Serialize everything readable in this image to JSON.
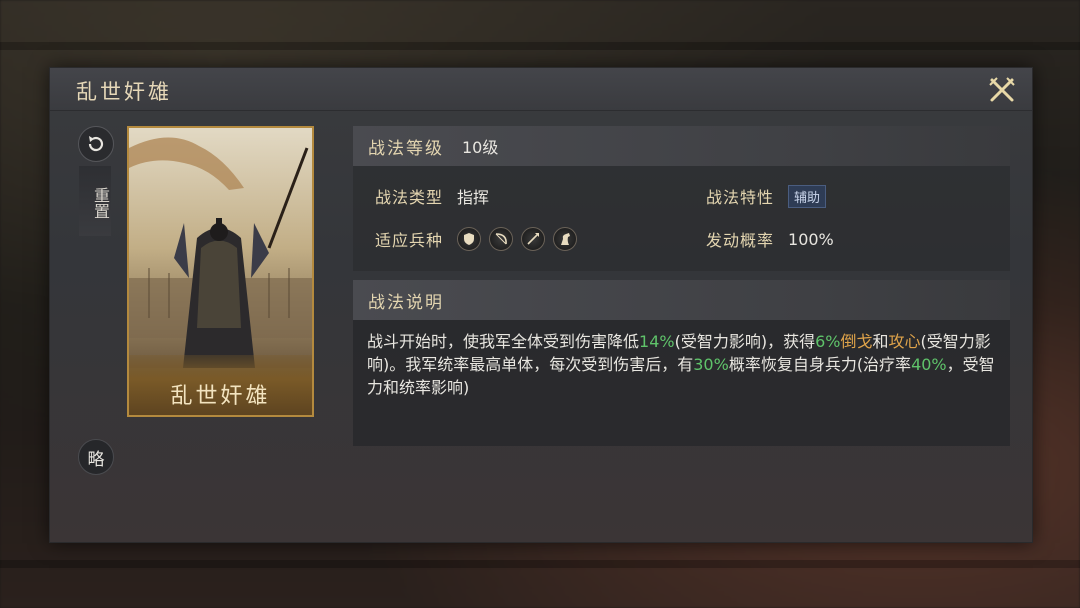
{
  "dialog": {
    "title": "乱世奸雄",
    "close_icon": "close-icon"
  },
  "side": {
    "reset_label": "重置",
    "brief_label": "略"
  },
  "card": {
    "name": "乱世奸雄"
  },
  "info": {
    "level_label": "战法等级",
    "level_value": "10级",
    "type_label": "战法类型",
    "type_value": "指挥",
    "trait_label": "战法特性",
    "trait_value": "辅助",
    "unit_label": "适应兵种",
    "units": [
      "shield-icon",
      "bow-icon",
      "spear-icon",
      "horse-icon"
    ],
    "rate_label": "发动概率",
    "rate_value": "100%"
  },
  "description": {
    "header": "战法说明",
    "t1": "战斗开始时，使我军全体受到伤害降低",
    "v1": "14%",
    "t2": "(受智力影响)，获得",
    "v2": "6%",
    "v3": "倒戈",
    "t3": "和",
    "v4": "攻心",
    "t4": "(受智力影响)。我军统率最高单体，每次受到伤害后，有",
    "v5": "30%",
    "t5": "概率恢复自身兵力(治疗率",
    "v6": "40%",
    "t6": "，受智力和统率影响)"
  },
  "colors": {
    "highlight_green": "#5fc36a",
    "highlight_orange": "#e0a44a",
    "label_gold": "#e3d5b0"
  }
}
